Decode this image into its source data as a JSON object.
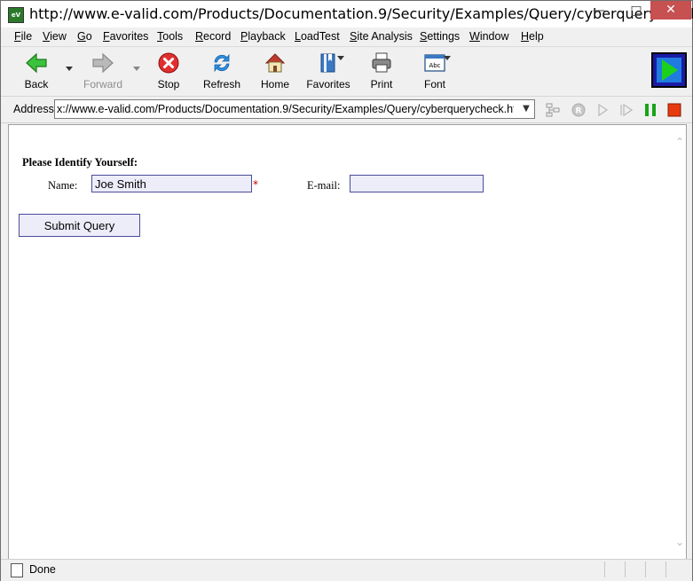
{
  "window": {
    "title": "http://www.e-valid.com/Products/Documentation.9/Security/Examples/Query/cyberquerycheck.h...",
    "app_icon_text": "eV",
    "minimize_icon": "minimize-icon",
    "maximize_icon": "maximize-icon",
    "close_icon": "close-icon"
  },
  "menu": [
    {
      "u": "F",
      "rest": "ile"
    },
    {
      "u": "V",
      "rest": "iew"
    },
    {
      "u": "G",
      "rest": "o"
    },
    {
      "u": "F",
      "rest": "avorites",
      "pre": ""
    },
    {
      "u": "T",
      "rest": "ools"
    },
    {
      "u": "R",
      "rest": "ecord"
    },
    {
      "u": "P",
      "rest": "layback"
    },
    {
      "u": "L",
      "rest": "oadTest"
    },
    {
      "u": "S",
      "rest": "ite Analysis"
    },
    {
      "u": "S",
      "rest": "ettings"
    },
    {
      "u": "W",
      "rest": "indow"
    },
    {
      "u": "H",
      "rest": "elp"
    }
  ],
  "toolbar": {
    "back": "Back",
    "forward": "Forward",
    "stop": "Stop",
    "refresh": "Refresh",
    "home": "Home",
    "favorites": "Favorites",
    "print": "Print",
    "font": "Font",
    "font_icon_text": "Abc"
  },
  "address": {
    "label": "Address",
    "value": "x://www.e-valid.com/Products/Documentation.9/Security/Examples/Query/cyberquerycheck.html"
  },
  "page": {
    "heading": "Please Identify Yourself:",
    "name_label": "Name:",
    "name_value": "Joe Smith",
    "required_mark": "*",
    "email_label": "E-mail:",
    "email_value": "",
    "submit_label": "Submit Query"
  },
  "status": {
    "text": "Done"
  },
  "colors": {
    "input_bg": "#ededfa",
    "input_border": "#4b4b9b",
    "required": "#c00000",
    "run_button": "#1a1aa6"
  }
}
